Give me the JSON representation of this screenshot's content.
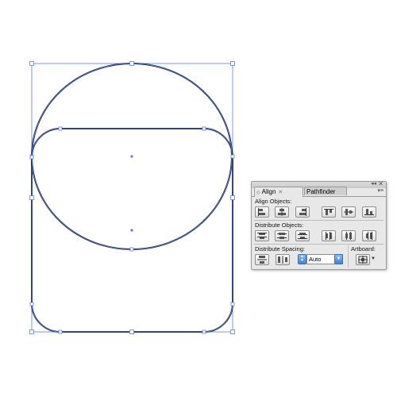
{
  "canvas": {
    "selection_color": "#5a7fdc",
    "stroke_color": "#1c2338",
    "shapes": [
      "circle",
      "rounded-rectangle"
    ]
  },
  "panel": {
    "tabs": [
      {
        "label": "Align",
        "active": true
      },
      {
        "label": "Pathfinder",
        "active": false
      }
    ],
    "align_objects_label": "Align Objects:",
    "distribute_objects_label": "Distribute Objects:",
    "distribute_spacing_label": "Distribute Spacing:",
    "artboard_label": "Artboard:",
    "spacing_value": "Auto",
    "align_buttons": [
      "horizontal-align-left",
      "horizontal-align-center",
      "horizontal-align-right",
      "vertical-align-top",
      "vertical-align-center",
      "vertical-align-bottom"
    ],
    "distribute_buttons": [
      "vertical-distribute-top",
      "vertical-distribute-center",
      "vertical-distribute-bottom",
      "horizontal-distribute-left",
      "horizontal-distribute-center",
      "horizontal-distribute-right"
    ],
    "accent_color": "#3f84d8"
  }
}
